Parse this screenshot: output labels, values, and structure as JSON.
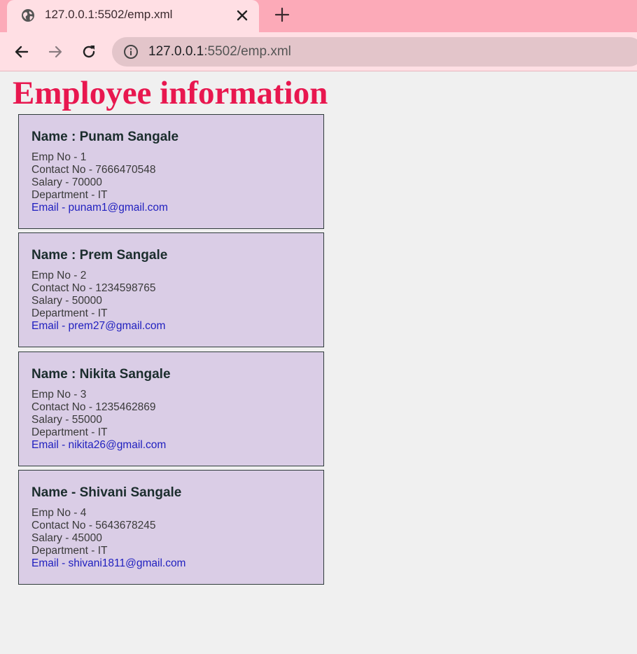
{
  "browser": {
    "tab_title": "127.0.0.1:5502/emp.xml",
    "url_host": "127.0.0.1",
    "url_path": ":5502/emp.xml"
  },
  "page": {
    "title": "Employee information"
  },
  "employees": [
    {
      "name": "Name : Punam Sangale",
      "emp_no": "Emp No - 1",
      "contact": "Contact No - 7666470548",
      "salary": "Salary - 70000",
      "department": "Department - IT",
      "email": "Email - punam1@gmail.com"
    },
    {
      "name": "Name : Prem Sangale",
      "emp_no": "Emp No - 2",
      "contact": "Contact No - 1234598765",
      "salary": "Salary - 50000",
      "department": "Department - IT",
      "email": "Email - prem27@gmail.com"
    },
    {
      "name": "Name : Nikita Sangale",
      "emp_no": "Emp No - 3",
      "contact": "Contact No - 1235462869",
      "salary": "Salary - 55000",
      "department": "Department - IT",
      "email": "Email - nikita26@gmail.com"
    },
    {
      "name": "Name - Shivani Sangale",
      "emp_no": "Emp No - 4",
      "contact": "Contact No - 5643678245",
      "salary": "Salary - 45000",
      "department": "Department - IT",
      "email": "Email - shivani1811@gmail.com"
    }
  ],
  "colors": {
    "title": "#e8174f",
    "card_background": "#dacde6",
    "email": "#1f1fbf",
    "tabstrip": "#fcaab8",
    "toolbar": "#ffdfe4"
  },
  "icons": {
    "favicon": "globe-icon",
    "close": "close-icon",
    "new_tab": "plus-icon",
    "back": "arrow-left-icon",
    "forward": "arrow-right-icon",
    "reload": "reload-icon",
    "site_info": "info-icon"
  }
}
